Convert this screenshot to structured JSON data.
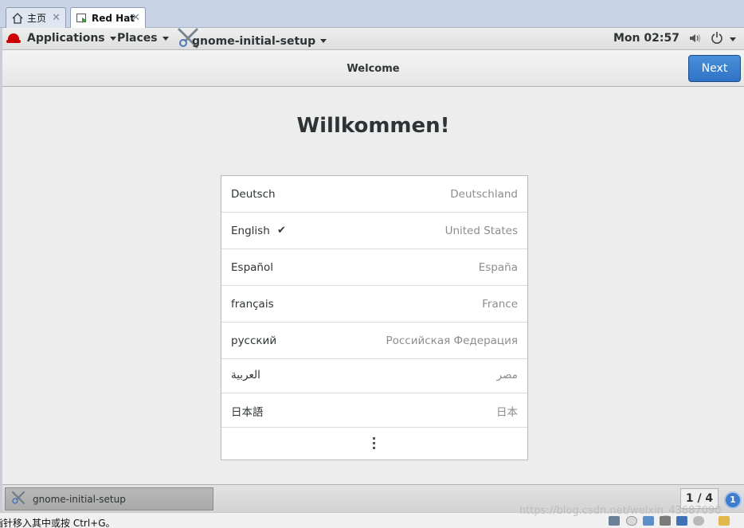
{
  "vm_tabs": [
    {
      "label": "主页",
      "icon": "home-icon"
    },
    {
      "label": "Red Hat",
      "icon": "vm-play-icon"
    }
  ],
  "topbar": {
    "applications": "Applications",
    "places": "Places",
    "app_menu": "gnome-initial-setup",
    "clock": "Mon 02:57"
  },
  "header": {
    "title": "Welcome",
    "next_label": "Next"
  },
  "heading": "Willkommen!",
  "languages": [
    {
      "name": "Deutsch",
      "region": "Deutschland",
      "selected": false
    },
    {
      "name": "English",
      "region": "United States",
      "selected": true
    },
    {
      "name": "Español",
      "region": "España",
      "selected": false
    },
    {
      "name": "français",
      "region": "France",
      "selected": false
    },
    {
      "name": "русский",
      "region": "Российская Федерация",
      "selected": false
    },
    {
      "name": "العربية",
      "region": "مصر",
      "selected": false
    },
    {
      "name": "日本語",
      "region": "日本",
      "selected": false
    }
  ],
  "check_glyph": "✔",
  "taskbar": {
    "task_label": "gnome-initial-setup",
    "workspace": "1 / 4",
    "notification_count": "1"
  },
  "statusbar": {
    "hint": "指针移入其中或按 Ctrl+G。"
  },
  "watermark": "https://blog.csdn.net/weixin_43687090",
  "colors": {
    "accent": "#3478d0",
    "redhat": "#cc0000"
  }
}
